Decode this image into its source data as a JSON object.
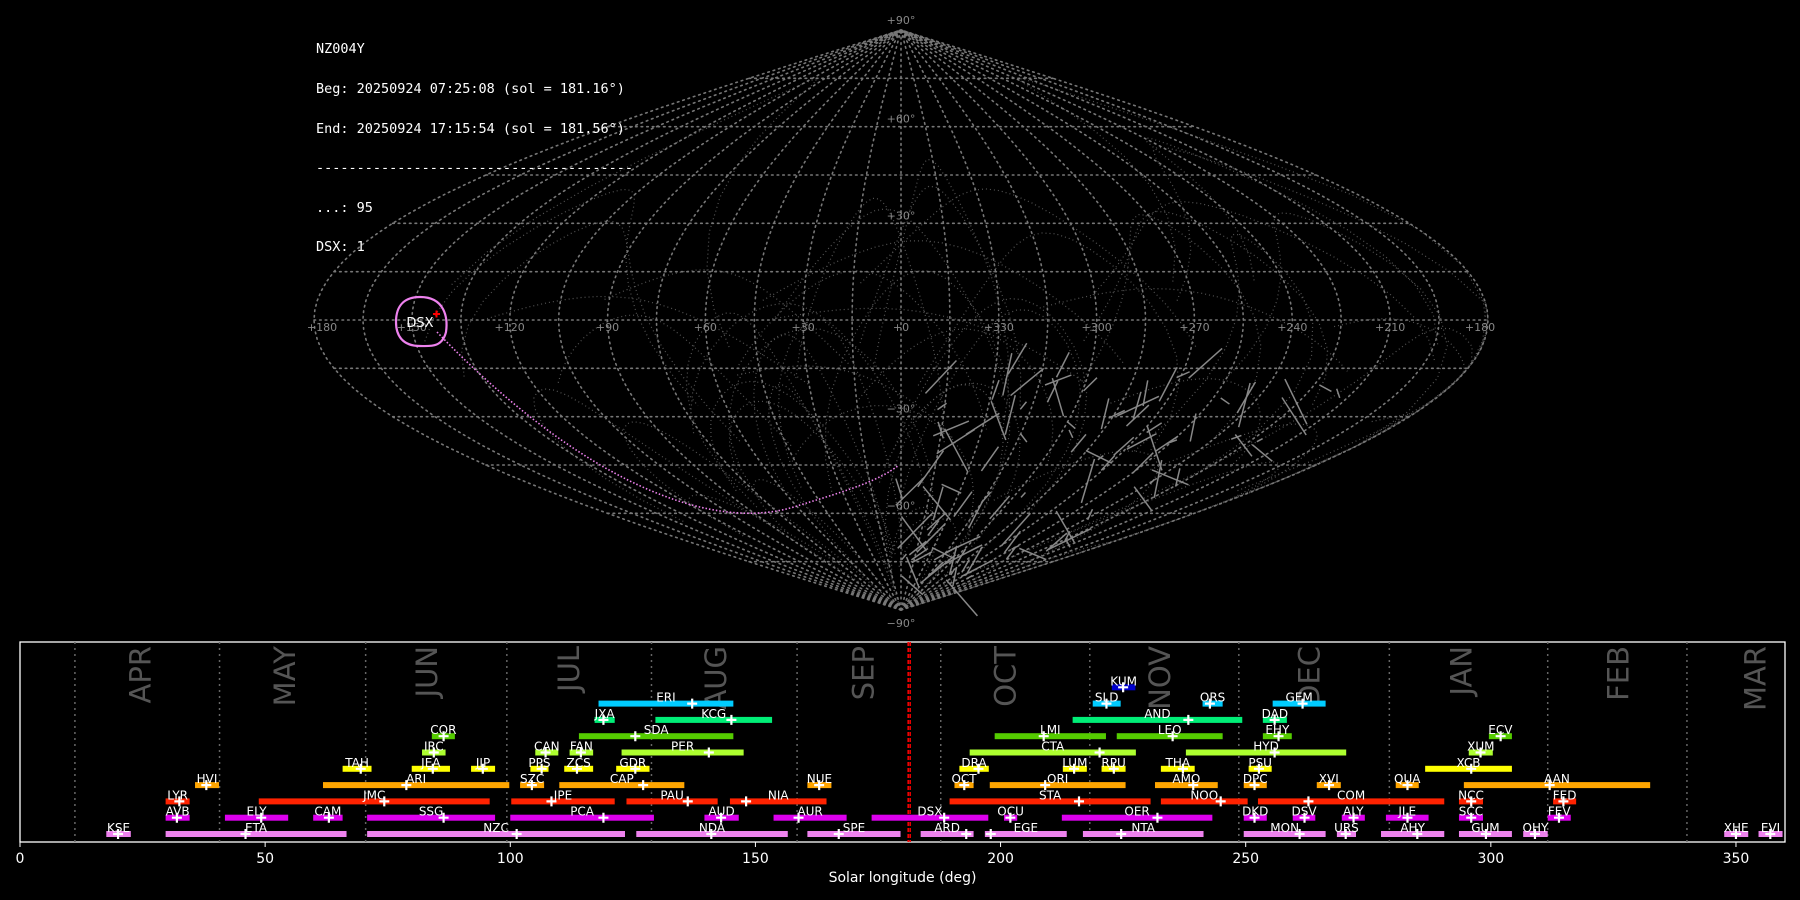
{
  "header": {
    "station": "NZ004Y",
    "begin": "Beg: 20250924 07:25:08 (sol = 181.16°)",
    "end": "End: 20250924 17:15:54 (sol = 181.56°)",
    "separator": "---------------------------------------",
    "sporadic": "...: 95",
    "dsx_count": "DSX: 1"
  },
  "sky_map": {
    "projection": "sinusoidal",
    "lon_labels": [
      "+180",
      "+150",
      "+120",
      "+90",
      "+60",
      "+30",
      "+0",
      "+330",
      "+300",
      "+270",
      "+240",
      "+210",
      "+180"
    ],
    "lat_labels": [
      {
        "lat": 90,
        "text": "+90°"
      },
      {
        "lat": 60,
        "text": "+60°"
      },
      {
        "lat": 30,
        "text": "+30°"
      },
      {
        "lat": -30,
        "text": "−30°"
      },
      {
        "lat": -60,
        "text": "−60°"
      },
      {
        "lat": -90,
        "text": "−90°"
      }
    ],
    "radiant": {
      "name": "DSX",
      "color": "#ee82ee",
      "marker_color": "#ff0000"
    },
    "streak_color": "#888888",
    "grid_color": "#777777"
  },
  "chart_data": {
    "type": "bar",
    "xlabel": "Solar longitude (deg)",
    "xlim": [
      0,
      360
    ],
    "xticks": [
      0,
      50,
      100,
      150,
      200,
      250,
      300,
      350
    ],
    "current_sol": [
      181.16,
      181.56
    ],
    "current_color": "#ff0000",
    "months": [
      {
        "name": "APR",
        "boundary": 11.2,
        "label_at": 24.6
      },
      {
        "name": "MAY",
        "boundary": 40.7,
        "label_at": 54
      },
      {
        "name": "JUN",
        "boundary": 70.5,
        "label_at": 83
      },
      {
        "name": "JUL",
        "boundary": 99.3,
        "label_at": 112
      },
      {
        "name": "AUG",
        "boundary": 128.8,
        "label_at": 142
      },
      {
        "name": "SEP",
        "boundary": 158.5,
        "label_at": 172
      },
      {
        "name": "OCT",
        "boundary": 187.8,
        "label_at": 201
      },
      {
        "name": "NOV",
        "boundary": 218.2,
        "label_at": 232.5
      },
      {
        "name": "DEC",
        "boundary": 248.6,
        "label_at": 263
      },
      {
        "name": "JAN",
        "boundary": 279.3,
        "label_at": 294
      },
      {
        "name": "FEB",
        "boundary": 311.6,
        "label_at": 326
      },
      {
        "name": "MAR",
        "boundary": 340,
        "label_at": 354
      }
    ],
    "row_colors": [
      "#ee82ee",
      "#dd00ee",
      "#ff2200",
      "#ffa500",
      "#ffff00",
      "#adff2f",
      "#55cc00",
      "#00ee77",
      "#00ccff",
      "#0000cc"
    ],
    "showers": [
      {
        "name": "KSE",
        "row": 0,
        "start": 17.6,
        "end": 22.6,
        "peak": 20
      },
      {
        "name": "ETA",
        "row": 0,
        "start": 29.7,
        "end": 66.6,
        "peak": 46
      },
      {
        "name": "NZC",
        "row": 0,
        "start": 70.8,
        "end": 123.4,
        "peak": 101.3
      },
      {
        "name": "NDA",
        "row": 0,
        "start": 125.7,
        "end": 156.6,
        "peak": 141
      },
      {
        "name": "SPE",
        "row": 0,
        "start": 160.6,
        "end": 179.6,
        "peak": 167
      },
      {
        "name": "ARD",
        "row": 0,
        "start": 183.7,
        "end": 194.5,
        "peak": 193
      },
      {
        "name": "EGE",
        "row": 0,
        "start": 196.8,
        "end": 213.5,
        "peak": 198
      },
      {
        "name": "NTA",
        "row": 0,
        "start": 216.8,
        "end": 241.4,
        "peak": 224.6
      },
      {
        "name": "MON",
        "row": 0,
        "start": 249.6,
        "end": 266.3,
        "peak": 261
      },
      {
        "name": "URS",
        "row": 0,
        "start": 268.6,
        "end": 272.5,
        "peak": 270.4
      },
      {
        "name": "AHY",
        "row": 0,
        "start": 277.6,
        "end": 290.5,
        "peak": 285
      },
      {
        "name": "GUM",
        "row": 0,
        "start": 293.5,
        "end": 304.3,
        "peak": 299
      },
      {
        "name": "OHY",
        "row": 0,
        "start": 306.6,
        "end": 311.6,
        "peak": 309
      },
      {
        "name": "XHE",
        "row": 0,
        "start": 347.6,
        "end": 352.5,
        "peak": 350
      },
      {
        "name": "EVI",
        "row": 0,
        "start": 354.6,
        "end": 359.5,
        "peak": 357
      },
      {
        "name": "AVB",
        "row": 1,
        "start": 29.7,
        "end": 34.6,
        "peak": 32
      },
      {
        "name": "ELY",
        "row": 1,
        "start": 41.8,
        "end": 54.7,
        "peak": 49.2
      },
      {
        "name": "CAM",
        "row": 1,
        "start": 59.8,
        "end": 65.8,
        "peak": 63
      },
      {
        "name": "SSG",
        "row": 1,
        "start": 70.8,
        "end": 96.9,
        "peak": 86.4
      },
      {
        "name": "PCA",
        "row": 1,
        "start": 100,
        "end": 129.3,
        "peak": 119
      },
      {
        "name": "AUD",
        "row": 1,
        "start": 139.6,
        "end": 146.6,
        "peak": 143
      },
      {
        "name": "AUR",
        "row": 1,
        "start": 153.7,
        "end": 168.6,
        "peak": 158.8
      },
      {
        "name": "DSX",
        "row": 1,
        "start": 173.7,
        "end": 197.5,
        "peak": 188.5
      },
      {
        "name": "OCU",
        "row": 1,
        "start": 200.7,
        "end": 203.4,
        "peak": 202
      },
      {
        "name": "OER",
        "row": 1,
        "start": 212.5,
        "end": 243.2,
        "peak": 232
      },
      {
        "name": "DKD",
        "row": 1,
        "start": 249.6,
        "end": 254.3,
        "peak": 251.8
      },
      {
        "name": "DSV",
        "row": 1,
        "start": 259.6,
        "end": 264.2,
        "peak": 262
      },
      {
        "name": "ALY",
        "row": 1,
        "start": 269.6,
        "end": 274.3,
        "peak": 272
      },
      {
        "name": "JLE",
        "row": 1,
        "start": 278.6,
        "end": 287.3,
        "peak": 283
      },
      {
        "name": "SCC",
        "row": 1,
        "start": 293.5,
        "end": 298.4,
        "peak": 296
      },
      {
        "name": "FEV",
        "row": 1,
        "start": 311.6,
        "end": 316.3,
        "peak": 313.9
      },
      {
        "name": "LYR",
        "row": 2,
        "start": 29.7,
        "end": 34.6,
        "peak": 32.5
      },
      {
        "name": "JMC",
        "row": 2,
        "start": 48.7,
        "end": 95.8,
        "peak": 74.3
      },
      {
        "name": "JPE",
        "row": 2,
        "start": 100.2,
        "end": 121.3,
        "peak": 108.4
      },
      {
        "name": "PAU",
        "row": 2,
        "start": 123.7,
        "end": 142.3,
        "peak": 136.2
      },
      {
        "name": "NIA",
        "row": 2,
        "start": 144.8,
        "end": 164.5,
        "peak": 148.1
      },
      {
        "name": "STA",
        "row": 2,
        "start": 189.6,
        "end": 230.6,
        "peak": 216
      },
      {
        "name": "NOO",
        "row": 2,
        "start": 232.7,
        "end": 250.4,
        "peak": 244.9
      },
      {
        "name": "COM",
        "row": 2,
        "start": 252.5,
        "end": 290.5,
        "peak": 262.8
      },
      {
        "name": "NCC",
        "row": 2,
        "start": 293.5,
        "end": 298.4,
        "peak": 296
      },
      {
        "name": "FED",
        "row": 2,
        "start": 312.7,
        "end": 317.4,
        "peak": 314.8
      },
      {
        "name": "HVI",
        "row": 3,
        "start": 35.7,
        "end": 40.6,
        "peak": 38
      },
      {
        "name": "ARI",
        "row": 3,
        "start": 61.8,
        "end": 99.8,
        "peak": 78.8
      },
      {
        "name": "SZC",
        "row": 3,
        "start": 102,
        "end": 106.9,
        "peak": 104.4
      },
      {
        "name": "CAP",
        "row": 3,
        "start": 110,
        "end": 135.5,
        "peak": 127.1
      },
      {
        "name": "NUE",
        "row": 3,
        "start": 160.6,
        "end": 165.5,
        "peak": 163
      },
      {
        "name": "OCT",
        "row": 3,
        "start": 190.6,
        "end": 194.5,
        "peak": 192.6
      },
      {
        "name": "ORI",
        "row": 3,
        "start": 197.8,
        "end": 225.5,
        "peak": 209.1
      },
      {
        "name": "AMO",
        "row": 3,
        "start": 231.5,
        "end": 244.3,
        "peak": 239.3
      },
      {
        "name": "DPC",
        "row": 3,
        "start": 249.6,
        "end": 254.3,
        "peak": 251.8
      },
      {
        "name": "XVI",
        "row": 3,
        "start": 264.5,
        "end": 269.4,
        "peak": 267
      },
      {
        "name": "QUA",
        "row": 3,
        "start": 280.6,
        "end": 285.3,
        "peak": 283
      },
      {
        "name": "AAN",
        "row": 3,
        "start": 294.5,
        "end": 332.5,
        "peak": 312
      },
      {
        "name": "TAH",
        "row": 4,
        "start": 65.8,
        "end": 71.7,
        "peak": 69.5
      },
      {
        "name": "JEA",
        "row": 4,
        "start": 79.9,
        "end": 87.7,
        "peak": 84.2
      },
      {
        "name": "JIP",
        "row": 4,
        "start": 92,
        "end": 96.9,
        "peak": 94.4
      },
      {
        "name": "PPS",
        "row": 4,
        "start": 104.1,
        "end": 107.8,
        "peak": 106.4
      },
      {
        "name": "ZCS",
        "row": 4,
        "start": 111,
        "end": 116.9,
        "peak": 113.6
      },
      {
        "name": "GDR",
        "row": 4,
        "start": 121.6,
        "end": 128.4,
        "peak": 125.5
      },
      {
        "name": "DRA",
        "row": 4,
        "start": 191.6,
        "end": 197.6,
        "peak": 195.5
      },
      {
        "name": "LUM",
        "row": 4,
        "start": 212.7,
        "end": 217.6,
        "peak": 215
      },
      {
        "name": "RPU",
        "row": 4,
        "start": 220.6,
        "end": 225.5,
        "peak": 223.1
      },
      {
        "name": "THA",
        "row": 4,
        "start": 232.7,
        "end": 239.6,
        "peak": 237.2
      },
      {
        "name": "PSU",
        "row": 4,
        "start": 250.6,
        "end": 255.3,
        "peak": 252.7
      },
      {
        "name": "XCB",
        "row": 4,
        "start": 286.6,
        "end": 304.3,
        "peak": 296
      },
      {
        "name": "IRC",
        "row": 5,
        "start": 82,
        "end": 86.8,
        "peak": 84.4
      },
      {
        "name": "CAN",
        "row": 5,
        "start": 105.1,
        "end": 109.8,
        "peak": 107.2
      },
      {
        "name": "FAN",
        "row": 5,
        "start": 112.1,
        "end": 116.9,
        "peak": 114.4
      },
      {
        "name": "PER",
        "row": 5,
        "start": 122.7,
        "end": 147.6,
        "peak": 140.5
      },
      {
        "name": "CTA",
        "row": 5,
        "start": 193.7,
        "end": 227.6,
        "peak": 220.2
      },
      {
        "name": "HYD",
        "row": 5,
        "start": 237.8,
        "end": 270.5,
        "peak": 255.9
      },
      {
        "name": "XUM",
        "row": 5,
        "start": 295.5,
        "end": 300.4,
        "peak": 297.9
      },
      {
        "name": "COR",
        "row": 6,
        "start": 84,
        "end": 88.7,
        "peak": 86.4
      },
      {
        "name": "SDA",
        "row": 6,
        "start": 114,
        "end": 145.5,
        "peak": 125.5
      },
      {
        "name": "LMI",
        "row": 6,
        "start": 198.8,
        "end": 221.5,
        "peak": 208.8
      },
      {
        "name": "LEO",
        "row": 6,
        "start": 223.7,
        "end": 245.3,
        "peak": 235.1
      },
      {
        "name": "EHY",
        "row": 6,
        "start": 253.5,
        "end": 259.4,
        "peak": 256.7
      },
      {
        "name": "ECV",
        "row": 6,
        "start": 299.6,
        "end": 304.3,
        "peak": 302
      },
      {
        "name": "JXA",
        "row": 7,
        "start": 117.2,
        "end": 121.3,
        "peak": 119
      },
      {
        "name": "KCG",
        "row": 7,
        "start": 129.6,
        "end": 153.4,
        "peak": 145.1
      },
      {
        "name": "AND",
        "row": 7,
        "start": 214.7,
        "end": 249.3,
        "peak": 238.3
      },
      {
        "name": "DAD",
        "row": 7,
        "start": 253.5,
        "end": 258.4,
        "peak": 255.9
      },
      {
        "name": "ERI",
        "row": 8,
        "start": 118,
        "end": 145.5,
        "peak": 137.1
      },
      {
        "name": "SLD",
        "row": 8,
        "start": 218.8,
        "end": 224.5,
        "peak": 221.6
      },
      {
        "name": "ORS",
        "row": 8,
        "start": 241.2,
        "end": 245.3,
        "peak": 242.7
      },
      {
        "name": "GEM",
        "row": 8,
        "start": 255.5,
        "end": 266.3,
        "peak": 261.6
      },
      {
        "name": "KUM",
        "row": 9,
        "start": 222.7,
        "end": 227.5,
        "peak": 225
      }
    ]
  }
}
